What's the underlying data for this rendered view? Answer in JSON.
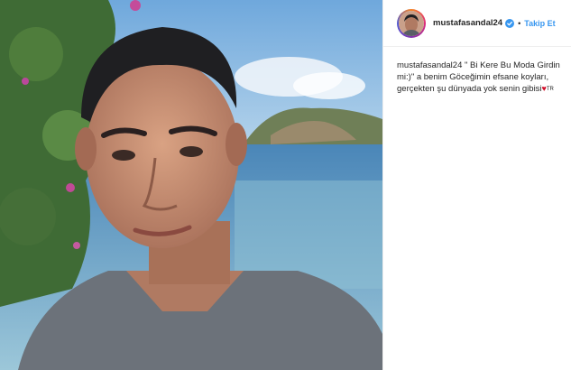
{
  "post": {
    "username": "mustafasandal24",
    "follow_label": "Takip Et",
    "separator": "•",
    "caption": {
      "username": "mustafasandal24",
      "text": "\" Bi Kere Bu Moda Girdin mi:)\" a benim Göceğimin efsane koyları, gerçekten şu dünyada yok senin gibisi",
      "heart": "♥",
      "flag": "TR"
    }
  },
  "colors": {
    "accent": "#3897f0",
    "text": "#262626",
    "heart": "#d2102c"
  },
  "icons": [
    "verified-badge-icon",
    "heart-icon"
  ]
}
